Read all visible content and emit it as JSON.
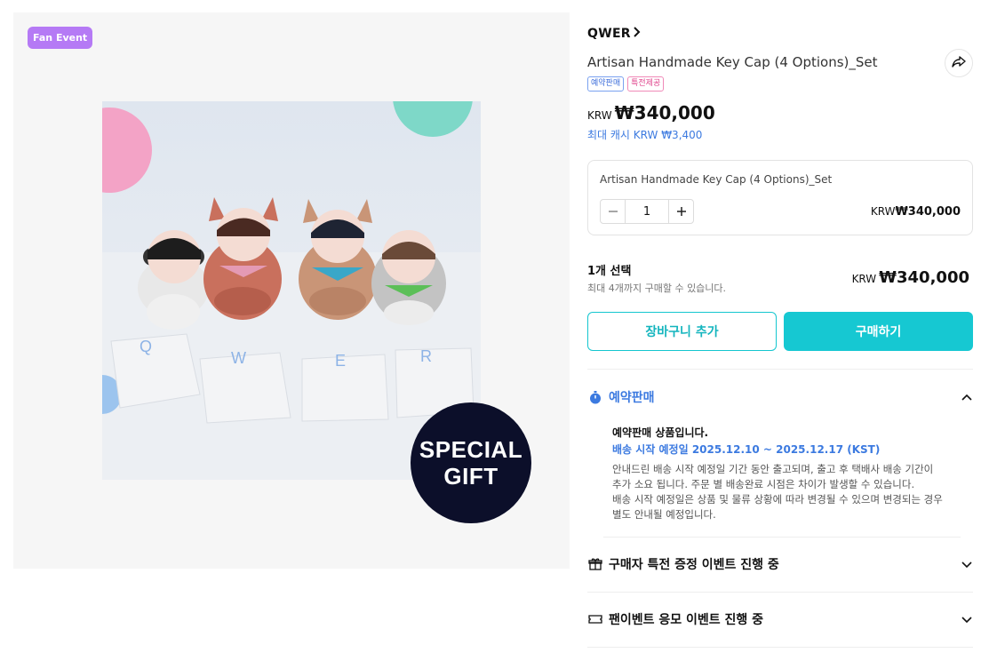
{
  "media": {
    "event_badge": "Fan Event",
    "gift_badge_line1": "SPECIAL",
    "gift_badge_line2": "GIFT",
    "keycap_letters": [
      "Q",
      "W",
      "E",
      "R"
    ]
  },
  "product": {
    "artist": "QWER",
    "title": "Artisan Handmade Key Cap (4 Options)_Set",
    "tags": [
      "예약판매",
      "특전제공"
    ],
    "currency": "KRW",
    "price": "₩340,000",
    "cash_reward": "최대 캐시 KRW ₩3,400"
  },
  "option": {
    "name": "Artisan Handmade Key Cap (4 Options)_Set",
    "quantity": "1",
    "currency": "KRW",
    "price": "₩340,000"
  },
  "summary": {
    "selected": "1개 선택",
    "limit": "최대 4개까지 구매할 수 있습니다.",
    "currency": "KRW",
    "total": "₩340,000"
  },
  "actions": {
    "cart": "장바구니 추가",
    "buy": "구매하기"
  },
  "accordion": {
    "preorder": {
      "label": "예약판매",
      "title": "예약판매 상품입니다.",
      "date": "배송 시작 예정일 2025.12.10 ~ 2025.12.17 (KST)",
      "desc1": "안내드린 배송 시작 예정일 기간 동안 출고되며, 출고 후 택배사 배송 기간이",
      "desc2": "추가 소요 됩니다. 주문 별 배송완료 시점은 차이가 발생할 수 있습니다.",
      "desc3": "배송 시작 예정일은 상품 및 물류 상황에 따라 변경될 수 있으며 변경되는 경우",
      "desc4": "별도 안내될 예정입니다."
    },
    "gift": {
      "label": "구매자 특전 증정 이벤트 진행 중"
    },
    "fan": {
      "label": "팬이벤트 응모 이벤트 진행 중"
    }
  },
  "colors": {
    "accent": "#16c8d2",
    "link_blue": "#3c7ae0",
    "event_purple": "#b57af5",
    "gift_navy": "#0c0f2a"
  }
}
